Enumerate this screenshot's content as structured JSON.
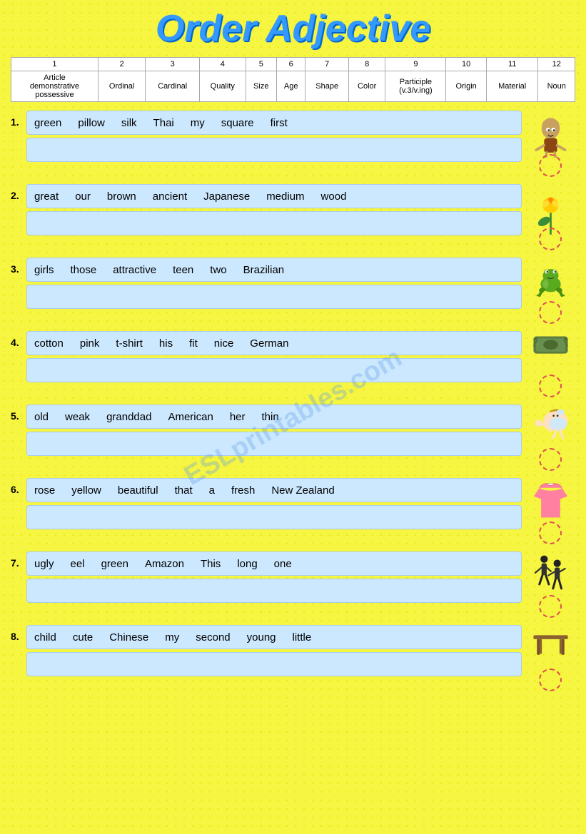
{
  "title": "Order Adjective",
  "watermark": "ESLprintables.com",
  "header": {
    "columns": [
      {
        "num": "1",
        "label": "Article\ndemonstrative\npossessive"
      },
      {
        "num": "2",
        "label": "Ordinal"
      },
      {
        "num": "3",
        "label": "Cardinal"
      },
      {
        "num": "4",
        "label": "Quality"
      },
      {
        "num": "5",
        "label": "Size"
      },
      {
        "num": "6",
        "label": "Age"
      },
      {
        "num": "7",
        "label": "Shape"
      },
      {
        "num": "8",
        "label": "Color"
      },
      {
        "num": "9",
        "label": "Participle\n(v.3/v.ing)"
      },
      {
        "num": "10",
        "label": "Origin"
      },
      {
        "num": "11",
        "label": "Material"
      },
      {
        "num": "12",
        "label": "Noun"
      }
    ]
  },
  "exercises": [
    {
      "number": "1.",
      "words": [
        "green",
        "pillow",
        "silk",
        "Thai",
        "my",
        "square",
        "first"
      ],
      "answer": "",
      "image_type": "goblin"
    },
    {
      "number": "2.",
      "words": [
        "great",
        "our",
        "brown",
        "ancient",
        "Japanese",
        "medium",
        "wood"
      ],
      "answer": "",
      "image_type": "rose"
    },
    {
      "number": "3.",
      "words": [
        "girls",
        "those",
        "attractive",
        "teen",
        "two",
        "Brazilian"
      ],
      "answer": "",
      "image_type": "frog"
    },
    {
      "number": "4.",
      "words": [
        "cotton",
        "pink",
        "t-shirt",
        "his",
        "fit",
        "nice",
        "German"
      ],
      "answer": "",
      "image_type": "pillow"
    },
    {
      "number": "5.",
      "words": [
        "old",
        "weak",
        "granddad",
        "American",
        "her",
        "thin"
      ],
      "answer": "",
      "image_type": "baby"
    },
    {
      "number": "6.",
      "words": [
        "rose",
        "yellow",
        "beautiful",
        "that",
        "a",
        "fresh",
        "New Zealand"
      ],
      "answer": "",
      "image_type": "shirt"
    },
    {
      "number": "7.",
      "words": [
        "ugly",
        "eel",
        "green",
        "Amazon",
        "This",
        "long",
        "one"
      ],
      "answer": "",
      "image_type": "dancers"
    },
    {
      "number": "8.",
      "words": [
        "child",
        "cute",
        "Chinese",
        "my",
        "second",
        "young",
        "little"
      ],
      "answer": "",
      "image_type": "table"
    }
  ]
}
